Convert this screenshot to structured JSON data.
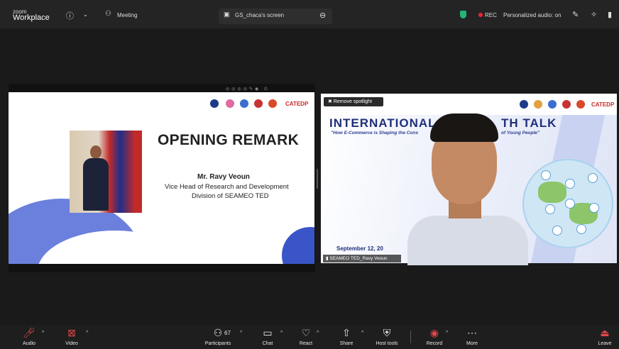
{
  "app": {
    "logo_top": "zoom",
    "logo_bottom": "Workplace"
  },
  "topbar": {
    "meeting_label": "Meeting",
    "screen_label": "GS_chaca's screen",
    "rec_label": "REC",
    "audio_label": "Personalized audio: on"
  },
  "left_slide": {
    "heading": "OPENING REMARK",
    "name": "Mr. Ravy Veoun",
    "role_line1": "Vice Head of Research and Development",
    "role_line2": "Division of SEAMEO TED",
    "brand": "CATEDP"
  },
  "right_slide": {
    "spotlight_label": "Remove spotlight",
    "title_left": "INTERNATIONAL",
    "title_right": "TH TALK",
    "subtitle_left": "\"How E-Commerce is Shaping the Cons",
    "subtitle_right": "of Young People\"",
    "date": "September 12, 20",
    "brand": "CATEDP",
    "participant_name": "SEAMEO TED_Ravy Veoun"
  },
  "toolbar": {
    "audio": "Audio",
    "video": "Video",
    "participants": "Participants",
    "participant_count": "67",
    "chat": "Chat",
    "react": "React",
    "share": "Share",
    "host_tools": "Host tools",
    "record": "Record",
    "more": "More",
    "leave": "Leave"
  }
}
